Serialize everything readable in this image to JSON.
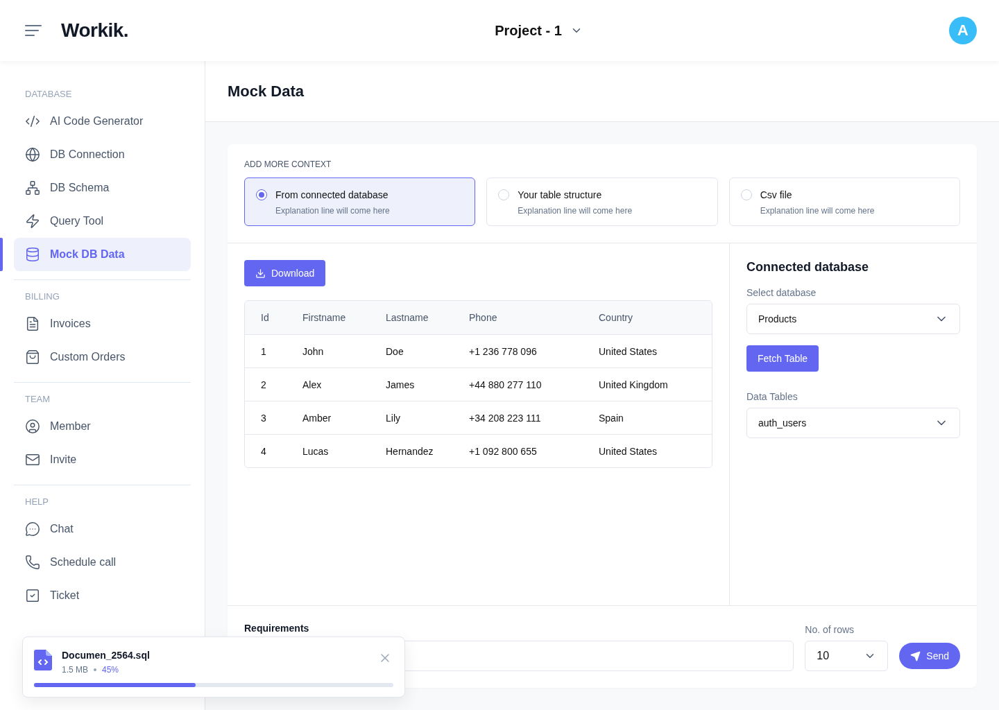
{
  "header": {
    "brand": "Workik.",
    "project": "Project - 1",
    "avatar": "A"
  },
  "sidebar": {
    "sections": [
      {
        "title": "DATABASE",
        "items": [
          {
            "label": "AI Code Generator",
            "kind": "code",
            "selected": false
          },
          {
            "label": "DB Connection",
            "kind": "globe",
            "selected": false
          },
          {
            "label": "DB Schema",
            "kind": "schema",
            "selected": false
          },
          {
            "label": "Query Tool",
            "kind": "bolt",
            "selected": false
          },
          {
            "label": "Mock DB Data",
            "kind": "database",
            "selected": true
          }
        ]
      },
      {
        "title": "BILLING",
        "items": [
          {
            "label": "Invoices",
            "kind": "file",
            "selected": false
          },
          {
            "label": "Custom Orders",
            "kind": "bag",
            "selected": false
          }
        ]
      },
      {
        "title": "TEAM",
        "items": [
          {
            "label": "Member",
            "kind": "user",
            "selected": false
          },
          {
            "label": "Invite",
            "kind": "mail",
            "selected": false
          }
        ]
      },
      {
        "title": "HELP",
        "items": [
          {
            "label": "Chat",
            "kind": "chat",
            "selected": false
          },
          {
            "label": "Schedule call",
            "kind": "phone",
            "selected": false
          },
          {
            "label": "Ticket",
            "kind": "ticket",
            "selected": false
          }
        ]
      }
    ]
  },
  "page_title": "Mock Data",
  "context": {
    "heading": "ADD MORE CONTEXT",
    "options": [
      {
        "title": "From connected database",
        "description": "Explanation line will come here",
        "selected": true
      },
      {
        "title": "Your table structure",
        "description": "Explanation line will come here",
        "selected": false
      },
      {
        "title": "Csv file",
        "description": "Explanation line will come here",
        "selected": false
      }
    ]
  },
  "download_button": "Download",
  "table": {
    "columns": [
      "Id",
      "Firstname",
      "Lastname",
      "Phone",
      "Country"
    ],
    "rows": [
      [
        "1",
        "John",
        "Doe",
        "+1 236 778 096",
        "United States"
      ],
      [
        "2",
        "Alex",
        "James",
        "+44 880 277 110",
        "United Kingdom"
      ],
      [
        "3",
        "Amber",
        "Lily",
        "+34 208 223 111",
        "Spain"
      ],
      [
        "4",
        "Lucas",
        "Hernandez",
        "+1 092 800 655",
        "United States"
      ]
    ]
  },
  "side_panel": {
    "title": "Connected database",
    "select_database": {
      "label": "Select database",
      "value": "Products"
    },
    "fetch_button": "Fetch Table",
    "data_tables": {
      "label": "Data Tables",
      "value": "auth_users"
    }
  },
  "requirements": {
    "label": "Requirements"
  },
  "rows_select": {
    "label": "No. of rows",
    "value": "10"
  },
  "send_button": "Send",
  "upload": {
    "filename": "Documen_2564.sql",
    "size": "1.5 MB",
    "percent": "45%",
    "level": 0.45
  }
}
